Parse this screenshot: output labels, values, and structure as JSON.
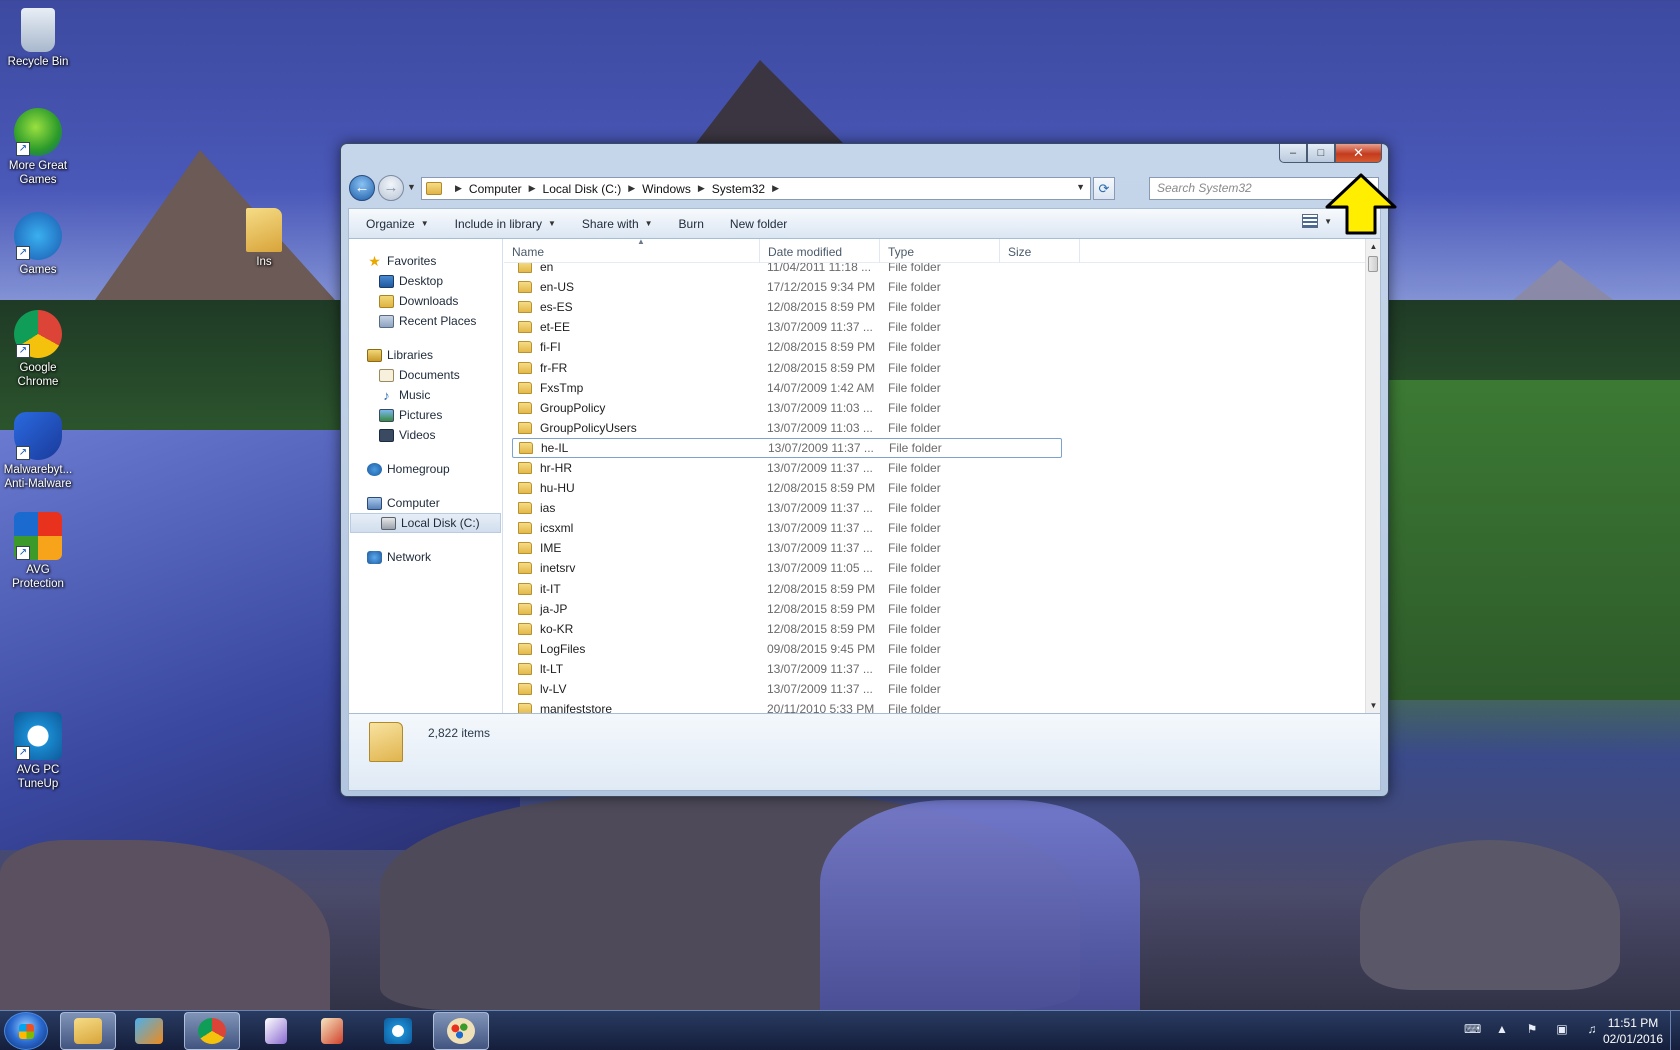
{
  "desktop": {
    "icons": [
      {
        "label": "Recycle Bin",
        "icon": "recycle-bin-icon"
      },
      {
        "label": "More Great Games",
        "icon": "games-icon"
      },
      {
        "label": "Games",
        "icon": "big-fish-games-icon"
      },
      {
        "label": "Google Chrome",
        "icon": "chrome-icon"
      },
      {
        "label": "Malwarebyt... Anti-Malware",
        "icon": "malwarebytes-icon"
      },
      {
        "label": "AVG Protection",
        "icon": "avg-icon"
      },
      {
        "label": "AVG PC TuneUp",
        "icon": "tuneup-icon"
      },
      {
        "label": "Ins",
        "icon": "folder-icon"
      }
    ]
  },
  "window": {
    "caption": {
      "minimize": "‒",
      "maximize": "□",
      "close": "✕"
    },
    "address": {
      "crumbs": [
        "Computer",
        "Local Disk (C:)",
        "Windows",
        "System32"
      ]
    },
    "search": {
      "placeholder": "Search System32"
    },
    "toolbar": {
      "organize": "Organize",
      "include_in_library": "Include in library",
      "share_with": "Share with",
      "burn": "Burn",
      "new_folder": "New folder"
    },
    "nav_pane": {
      "favorites": {
        "label": "Favorites",
        "items": [
          "Desktop",
          "Downloads",
          "Recent Places"
        ]
      },
      "libraries": {
        "label": "Libraries",
        "items": [
          "Documents",
          "Music",
          "Pictures",
          "Videos"
        ]
      },
      "homegroup": "Homegroup",
      "computer": {
        "label": "Computer",
        "items": [
          "Local Disk (C:)"
        ]
      },
      "network": "Network"
    },
    "columns": {
      "name": "Name",
      "date_modified": "Date modified",
      "type": "Type",
      "size": "Size"
    },
    "files": [
      {
        "name": "en",
        "date": "11/04/2011 11:18 ...",
        "type": "File folder"
      },
      {
        "name": "en-US",
        "date": "17/12/2015 9:34 PM",
        "type": "File folder"
      },
      {
        "name": "es-ES",
        "date": "12/08/2015 8:59 PM",
        "type": "File folder"
      },
      {
        "name": "et-EE",
        "date": "13/07/2009 11:37 ...",
        "type": "File folder"
      },
      {
        "name": "fi-FI",
        "date": "12/08/2015 8:59 PM",
        "type": "File folder"
      },
      {
        "name": "fr-FR",
        "date": "12/08/2015 8:59 PM",
        "type": "File folder"
      },
      {
        "name": "FxsTmp",
        "date": "14/07/2009 1:42 AM",
        "type": "File folder"
      },
      {
        "name": "GroupPolicy",
        "date": "13/07/2009 11:03 ...",
        "type": "File folder"
      },
      {
        "name": "GroupPolicyUsers",
        "date": "13/07/2009 11:03 ...",
        "type": "File folder"
      },
      {
        "name": "he-IL",
        "date": "13/07/2009 11:37 ...",
        "type": "File folder"
      },
      {
        "name": "hr-HR",
        "date": "13/07/2009 11:37 ...",
        "type": "File folder"
      },
      {
        "name": "hu-HU",
        "date": "12/08/2015 8:59 PM",
        "type": "File folder"
      },
      {
        "name": "ias",
        "date": "13/07/2009 11:37 ...",
        "type": "File folder"
      },
      {
        "name": "icsxml",
        "date": "13/07/2009 11:37 ...",
        "type": "File folder"
      },
      {
        "name": "IME",
        "date": "13/07/2009 11:37 ...",
        "type": "File folder"
      },
      {
        "name": "inetsrv",
        "date": "13/07/2009 11:05 ...",
        "type": "File folder"
      },
      {
        "name": "it-IT",
        "date": "12/08/2015 8:59 PM",
        "type": "File folder"
      },
      {
        "name": "ja-JP",
        "date": "12/08/2015 8:59 PM",
        "type": "File folder"
      },
      {
        "name": "ko-KR",
        "date": "12/08/2015 8:59 PM",
        "type": "File folder"
      },
      {
        "name": "LogFiles",
        "date": "09/08/2015 9:45 PM",
        "type": "File folder"
      },
      {
        "name": "lt-LT",
        "date": "13/07/2009 11:37 ...",
        "type": "File folder"
      },
      {
        "name": "lv-LV",
        "date": "13/07/2009 11:37 ...",
        "type": "File folder"
      },
      {
        "name": "manifeststore",
        "date": "20/11/2010 5:33 PM",
        "type": "File folder"
      }
    ],
    "focused_file": "he-IL",
    "status": {
      "item_count": "2,822 items"
    }
  },
  "taskbar": {
    "apps": [
      "explorer-icon",
      "media-player-icon",
      "chrome-icon",
      "solitaire-icon",
      "games-icon",
      "tuneup-icon",
      "paint-icon"
    ],
    "clock": {
      "time": "11:51 PM",
      "date": "02/01/2016"
    }
  },
  "colors": {
    "annotation_arrow": "#ffee00",
    "close_button": "#c43b1e"
  }
}
